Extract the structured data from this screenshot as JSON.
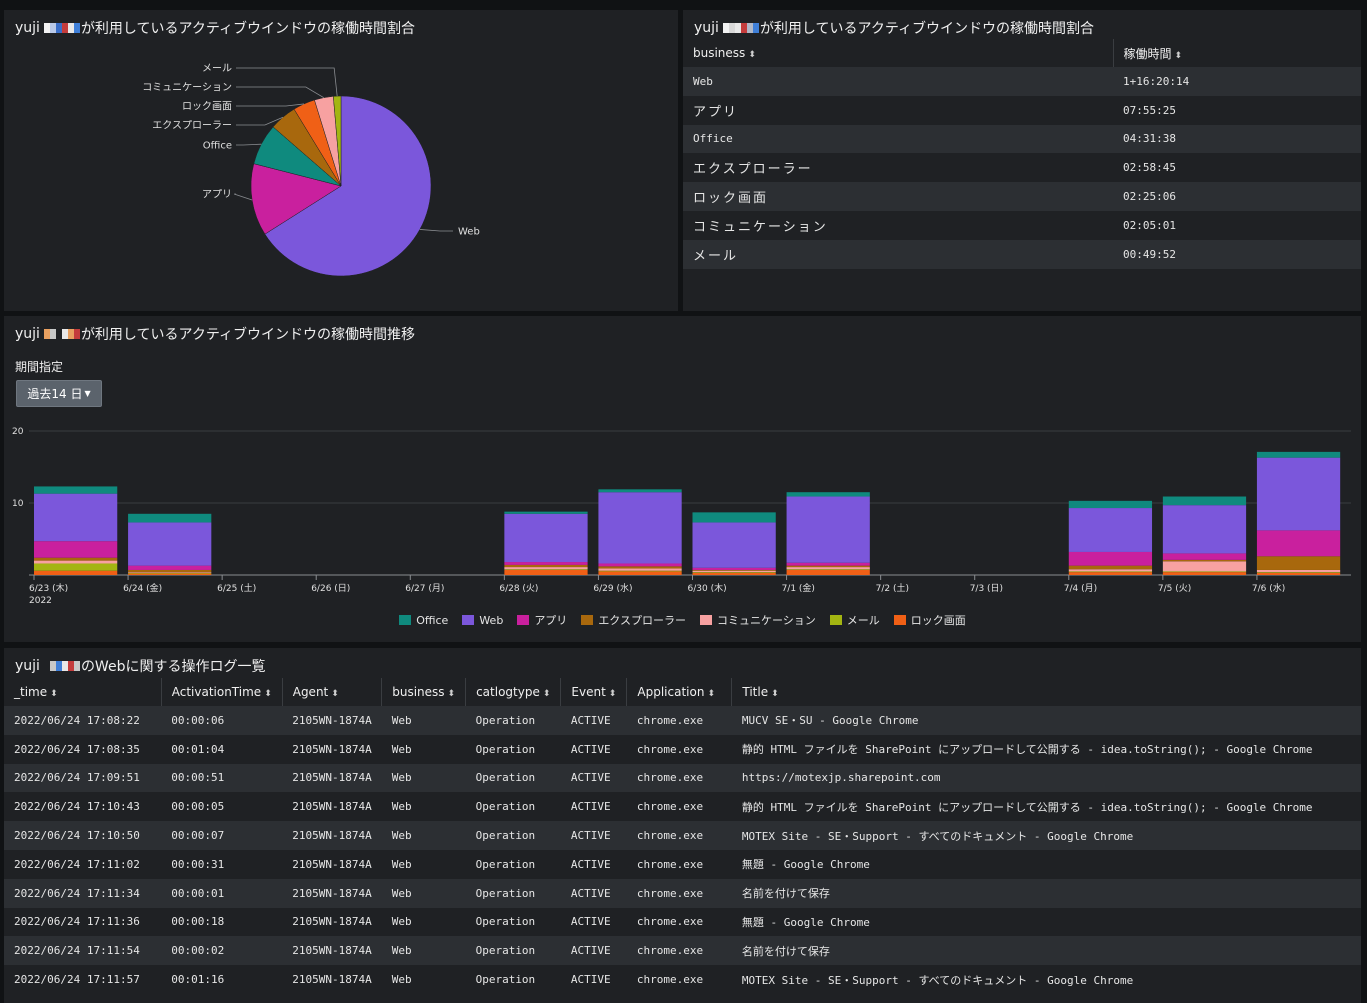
{
  "colors": {
    "Office": "#0f8a7e",
    "Web": "#7b57db",
    "アプリ": "#c9209e",
    "エクスプローラー": "#a8680d",
    "コミュニケーション": "#f7a1a1",
    "メール": "#a3b512",
    "ロック画面": "#f06016"
  },
  "pie_panel": {
    "title_prefix": "yuji",
    "title_suffix": "が利用しているアクティブウインドウの稼働時間割合"
  },
  "table_panel": {
    "title_prefix": "yuji",
    "title_suffix": "が利用しているアクティブウインドウの稼働時間割合",
    "headers": [
      "business",
      "稼働時間"
    ],
    "rows": [
      [
        "Web",
        "1+16:20:14"
      ],
      [
        "アプリ",
        "07:55:25"
      ],
      [
        "Office",
        "04:31:38"
      ],
      [
        "エクスプローラー",
        "02:58:45"
      ],
      [
        "ロック画面",
        "02:25:06"
      ],
      [
        "コミュニケーション",
        "02:05:01"
      ],
      [
        "メール",
        "00:49:52"
      ]
    ]
  },
  "trend_panel": {
    "title_prefix": "yuji",
    "title_suffix": "が利用しているアクティブウインドウの稼働時間推移",
    "period_label": "期間指定",
    "range_button": "過去14 日"
  },
  "log_panel": {
    "title_prefix": "yuji",
    "title_suffix": "のWebに関する操作ログ一覧",
    "headers": [
      "_time",
      "ActivationTime",
      "Agent",
      "business",
      "catlogtype",
      "Event",
      "Application",
      "Title"
    ],
    "rows": [
      [
        "2022/06/24 17:08:22",
        "00:00:06",
        "2105WN-1874A",
        "Web",
        "Operation",
        "ACTIVE",
        "chrome.exe",
        "MUCV SE・SU - Google Chrome"
      ],
      [
        "2022/06/24 17:08:35",
        "00:01:04",
        "2105WN-1874A",
        "Web",
        "Operation",
        "ACTIVE",
        "chrome.exe",
        "静的 HTML ファイルを SharePoint にアップロードして公開する - idea.toString(); - Google Chrome"
      ],
      [
        "2022/06/24 17:09:51",
        "00:00:51",
        "2105WN-1874A",
        "Web",
        "Operation",
        "ACTIVE",
        "chrome.exe",
        "https://motexjp.sharepoint.com"
      ],
      [
        "2022/06/24 17:10:43",
        "00:00:05",
        "2105WN-1874A",
        "Web",
        "Operation",
        "ACTIVE",
        "chrome.exe",
        "静的 HTML ファイルを SharePoint にアップロードして公開する - idea.toString(); - Google Chrome"
      ],
      [
        "2022/06/24 17:10:50",
        "00:00:07",
        "2105WN-1874A",
        "Web",
        "Operation",
        "ACTIVE",
        "chrome.exe",
        "MOTEX Site - SE・Support - すべてのドキュメント - Google Chrome"
      ],
      [
        "2022/06/24 17:11:02",
        "00:00:31",
        "2105WN-1874A",
        "Web",
        "Operation",
        "ACTIVE",
        "chrome.exe",
        "無題 - Google Chrome"
      ],
      [
        "2022/06/24 17:11:34",
        "00:00:01",
        "2105WN-1874A",
        "Web",
        "Operation",
        "ACTIVE",
        "chrome.exe",
        "名前を付けて保存"
      ],
      [
        "2022/06/24 17:11:36",
        "00:00:18",
        "2105WN-1874A",
        "Web",
        "Operation",
        "ACTIVE",
        "chrome.exe",
        "無題 - Google Chrome"
      ],
      [
        "2022/06/24 17:11:54",
        "00:00:02",
        "2105WN-1874A",
        "Web",
        "Operation",
        "ACTIVE",
        "chrome.exe",
        "名前を付けて保存"
      ],
      [
        "2022/06/24 17:11:57",
        "00:01:16",
        "2105WN-1874A",
        "Web",
        "Operation",
        "ACTIVE",
        "chrome.exe",
        "MOTEX Site - SE・Support - すべてのドキュメント - Google Chrome"
      ]
    ]
  },
  "chart_data": [
    {
      "type": "pie",
      "slices": [
        {
          "label": "Web",
          "value": 40.34
        },
        {
          "label": "アプリ",
          "value": 7.92
        },
        {
          "label": "Office",
          "value": 4.53
        },
        {
          "label": "エクスプローラー",
          "value": 2.98
        },
        {
          "label": "ロック画面",
          "value": 2.42
        },
        {
          "label": "コミュニケーション",
          "value": 2.08
        },
        {
          "label": "メール",
          "value": 0.83
        }
      ]
    },
    {
      "type": "bar",
      "stacked": true,
      "categories": [
        "6/23 (木)",
        "6/24 (金)",
        "6/25 (土)",
        "6/26 (日)",
        "6/27 (月)",
        "6/28 (火)",
        "6/29 (水)",
        "6/30 (木)",
        "7/1 (金)",
        "7/2 (土)",
        "7/3 (日)",
        "7/4 (月)",
        "7/5 (火)",
        "7/6 (水)"
      ],
      "first_category_sub": "2022",
      "ylim": [
        0,
        20
      ],
      "yticks": [
        10,
        20
      ],
      "series": [
        {
          "name": "ロック画面",
          "values": [
            0.6,
            0.2,
            0,
            0,
            0,
            0.7,
            0.5,
            0.3,
            0.7,
            0,
            0,
            0.4,
            0.4,
            0.3
          ]
        },
        {
          "name": "メール",
          "values": [
            1.0,
            0.1,
            0,
            0,
            0,
            0.1,
            0.1,
            0.1,
            0.1,
            0,
            0,
            0.1,
            0.1,
            0.1
          ]
        },
        {
          "name": "コミュニケーション",
          "values": [
            0.4,
            0.1,
            0,
            0,
            0,
            0.3,
            0.3,
            0.2,
            0.3,
            0,
            0,
            0.3,
            1.4,
            0.3
          ]
        },
        {
          "name": "エクスプローラー",
          "values": [
            0.4,
            0.3,
            0,
            0,
            0,
            0.3,
            0.3,
            0.1,
            0.2,
            0,
            0,
            0.5,
            0.2,
            1.9
          ]
        },
        {
          "name": "アプリ",
          "values": [
            2.3,
            0.6,
            0,
            0,
            0,
            0.4,
            0.4,
            0.3,
            0.4,
            0,
            0,
            1.9,
            0.9,
            3.6
          ]
        },
        {
          "name": "Web",
          "values": [
            6.6,
            6.0,
            0,
            0,
            0,
            6.7,
            9.9,
            6.3,
            9.2,
            0,
            0,
            6.1,
            6.7,
            10.1
          ]
        },
        {
          "name": "Office",
          "values": [
            1.0,
            1.2,
            0,
            0,
            0,
            0.3,
            0.4,
            1.4,
            0.6,
            0,
            0,
            1.0,
            1.2,
            0.8
          ]
        }
      ],
      "legend": [
        "Office",
        "Web",
        "アプリ",
        "エクスプローラー",
        "コミュニケーション",
        "メール",
        "ロック画面"
      ],
      "legend_position": "bottom"
    }
  ]
}
